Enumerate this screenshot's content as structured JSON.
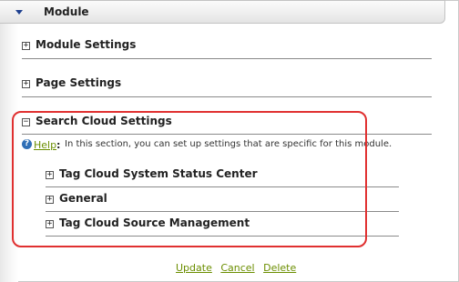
{
  "header": {
    "title": "Module",
    "icon": "triangle-down-icon"
  },
  "sections": {
    "module_settings": {
      "label": "Module Settings",
      "toggle": "+"
    },
    "page_settings": {
      "label": "Page Settings",
      "toggle": "+"
    },
    "search_cloud_settings": {
      "label": "Search Cloud Settings",
      "toggle": "−"
    }
  },
  "help": {
    "link_label": "Help",
    "colon": ":",
    "text": "In this section, you can set up settings that are specific for this module."
  },
  "subsections": {
    "status_center": {
      "label": "Tag Cloud System Status Center",
      "toggle": "+"
    },
    "general": {
      "label": "General",
      "toggle": "+"
    },
    "source_management": {
      "label": "Tag Cloud Source Management",
      "toggle": "+"
    }
  },
  "actions": {
    "update_label": "Update",
    "cancel_label": "Cancel",
    "delete_label": "Delete"
  },
  "colors": {
    "link": "#6b8e00",
    "highlight": "#e03030",
    "header_arrow": "#1d3f8f"
  }
}
